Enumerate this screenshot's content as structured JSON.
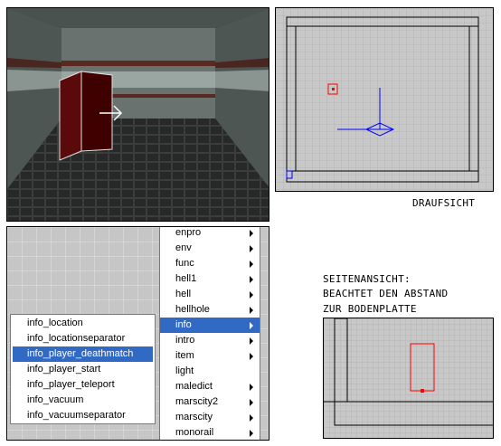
{
  "captions": {
    "top_view": "DRAUFSICHT",
    "side_view_line1": "SEITENANSICHT:",
    "side_view_line2": "BEACHTET DEN ABSTAND",
    "side_view_line3": "ZUR BODENPLATTE"
  },
  "class_menu": {
    "items": [
      {
        "label": "enpro",
        "submenu": true
      },
      {
        "label": "env",
        "submenu": true
      },
      {
        "label": "func",
        "submenu": true
      },
      {
        "label": "hell1",
        "submenu": true
      },
      {
        "label": "hell",
        "submenu": true
      },
      {
        "label": "hellhole",
        "submenu": true
      },
      {
        "label": "info",
        "submenu": true,
        "selected": true
      },
      {
        "label": "intro",
        "submenu": true
      },
      {
        "label": "item",
        "submenu": true
      },
      {
        "label": "light",
        "submenu": false
      },
      {
        "label": "maledict",
        "submenu": true
      },
      {
        "label": "marscity2",
        "submenu": true
      },
      {
        "label": "marscity",
        "submenu": true
      },
      {
        "label": "monorail",
        "submenu": true
      }
    ]
  },
  "info_submenu": {
    "items": [
      {
        "label": "info_location"
      },
      {
        "label": "info_locationseparator"
      },
      {
        "label": "info_player_deathmatch",
        "selected": true
      },
      {
        "label": "info_player_start"
      },
      {
        "label": "info_player_teleport"
      },
      {
        "label": "info_vacuum"
      },
      {
        "label": "info_vacuumseparator"
      }
    ]
  },
  "colors": {
    "selection": "#316ac5",
    "entity_box": "#4a0000",
    "selected_brush": "#ff0000",
    "gizmo": "#0000ff",
    "grid_background": "#c8c8c8"
  }
}
